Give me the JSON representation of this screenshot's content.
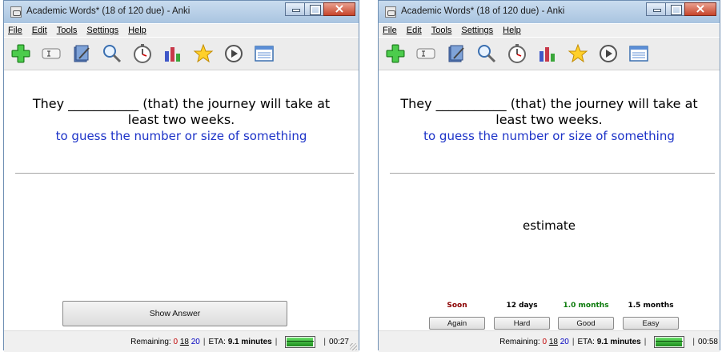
{
  "windows": [
    {
      "title": "Academic Words* (18 of 120 due) - Anki",
      "menu": [
        "File",
        "Edit",
        "Tools",
        "Settings",
        "Help"
      ],
      "card": {
        "question_line1": "They ___________ (that) the journey will take at",
        "question_line2": "least two weeks.",
        "definition": "to guess the number or size of something"
      },
      "show_answer_label": "Show Answer",
      "status": {
        "remaining_label": "Remaining:",
        "new": "0",
        "learning": "18",
        "review": "20",
        "eta_label": "ETA:",
        "eta": "9.1 minutes",
        "progress_fraction": 0.95,
        "timer": "00:27"
      }
    },
    {
      "title": "Academic Words* (18 of 120 due) - Anki",
      "menu": [
        "File",
        "Edit",
        "Tools",
        "Settings",
        "Help"
      ],
      "card": {
        "question_line1": "They ___________ (that) the journey will take at",
        "question_line2": "least two weeks.",
        "definition": "to guess the number or size of something",
        "answer": "estimate"
      },
      "ease": {
        "times": [
          "Soon",
          "12 days",
          "1.0 months",
          "1.5 months"
        ],
        "labels": [
          "Again",
          "Hard",
          "Good",
          "Easy"
        ]
      },
      "status": {
        "remaining_label": "Remaining:",
        "new": "0",
        "learning": "18",
        "review": "20",
        "eta_label": "ETA:",
        "eta": "9.1 minutes",
        "progress_fraction": 0.95,
        "timer": "00:58"
      }
    }
  ],
  "toolbar_icons": [
    "add-icon",
    "edit-card-icon",
    "browse-icon",
    "search-icon",
    "timer-icon",
    "statistics-icon",
    "mark-star-icon",
    "replay-icon",
    "card-list-icon"
  ],
  "colors": {
    "definition": "#1d33c8",
    "again_time": "#8b0000",
    "good_time": "#0a7a0a",
    "remaining_new": "#c00000",
    "remaining_review": "#0000c0"
  }
}
